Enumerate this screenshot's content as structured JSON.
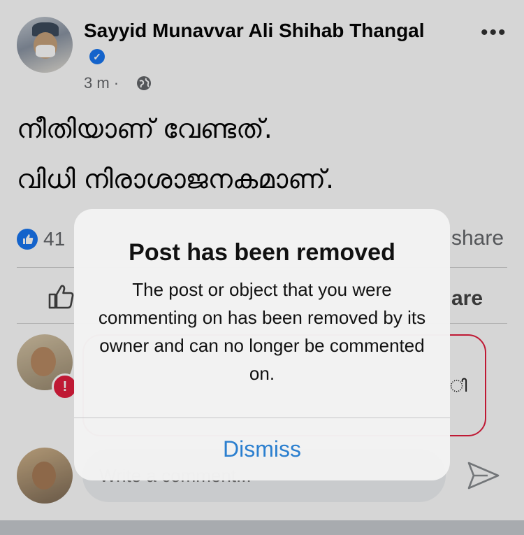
{
  "post": {
    "author": "Sayyid Munavvar Ali Shihab Thangal",
    "time": "3 m ·",
    "more_icon": "more-dots-icon",
    "audience_icon": "globe-icon",
    "lines": [
      "നീതിയാണ് വേണ്ടത്.",
      "വിധി നിരാശാജനകമാണ്."
    ]
  },
  "reactions": {
    "count": "41",
    "share_text": "share",
    "like_icon": "like-reaction-icon"
  },
  "actions": {
    "share_label_partial": "are",
    "like_icon": "thumbs-up-icon"
  },
  "comment": {
    "visible_text": "ി",
    "error_icon": "error-badge-icon"
  },
  "composer": {
    "placeholder_partial": "Write a comment...",
    "send_icon": "send-icon"
  },
  "dialog": {
    "title": "Post has been removed",
    "message": "The post or object that you were commenting on has been removed by its owner and can no longer be commented on.",
    "dismiss_label": "Dismiss"
  },
  "colors": {
    "verified": "#1877f2",
    "dismiss": "#2b7fcf",
    "error": "#e41e3f"
  }
}
